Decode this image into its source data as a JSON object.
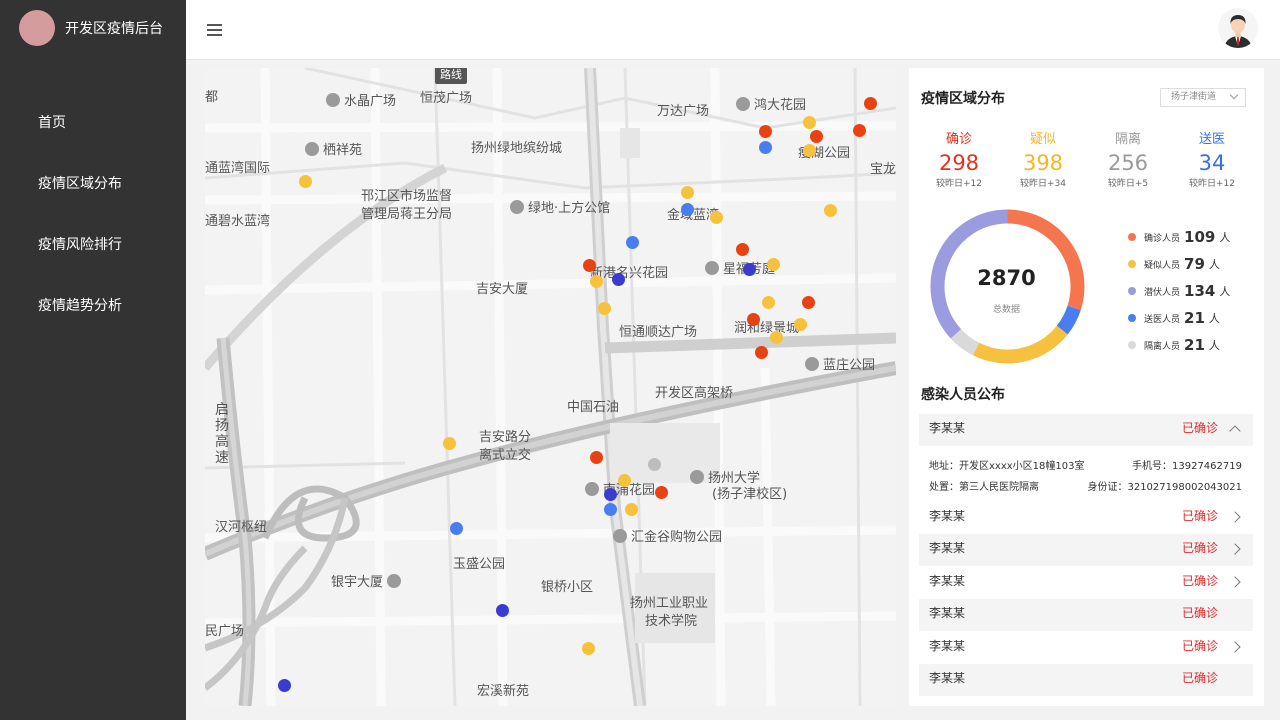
{
  "app": {
    "title": "开发区疫情后台"
  },
  "nav": {
    "items": [
      {
        "label": "首页"
      },
      {
        "label": "疫情区域分布"
      },
      {
        "label": "疫情风险排行"
      },
      {
        "label": "疫情趋势分析"
      }
    ]
  },
  "map": {
    "labels": [
      "都",
      "水晶广场",
      "恒茂广场",
      "万达广场",
      "鸿大花园",
      "栖祥苑",
      "扬州绿地缤纷城",
      "瘦湖公园",
      "宝龙",
      "通蓝湾国际",
      "邗江区市场监督",
      "管理局蒋王分局",
      "绿地·上方公馆",
      "金域蓝湾",
      "通碧水蓝湾",
      "新港名兴花园",
      "星福芳庭",
      "吉安大厦",
      "恒通顺达广场",
      "润和绿景城",
      "中国石油",
      "开发区高架桥",
      "蓝庄公园",
      "启扬高速",
      "吉安路分",
      "离式立交",
      "南浦花园",
      "扬州大学",
      "(扬子津校区)",
      "汉河枢纽",
      "汇金谷购物公园",
      "玉盛公园",
      "银宇大厦",
      "银桥小区",
      "扬州工业职业",
      "技术学院",
      "民广场",
      "宏溪新苑",
      "路线"
    ]
  },
  "panel": {
    "title": "疫情区域分布",
    "district_select": "扬子津街道",
    "stats": [
      {
        "label": "确诊",
        "value": "298",
        "sub": "较昨日+12",
        "color": "#e0341c"
      },
      {
        "label": "疑似",
        "value": "398",
        "sub": "较昨日+34",
        "color": "#f5b52b"
      },
      {
        "label": "隔离",
        "value": "256",
        "sub": "较昨日+5",
        "color": "#9a9a9a"
      },
      {
        "label": "送医",
        "value": "34",
        "sub": "较昨日+12",
        "color": "#3a6fe8"
      }
    ],
    "total": {
      "value": "2870",
      "label": "总数据"
    },
    "legend": [
      {
        "label": "确诊人员",
        "value": "109",
        "unit": "人",
        "color": "#f5764e"
      },
      {
        "label": "疑似人员",
        "value": "79",
        "unit": "人",
        "color": "#f7c140"
      },
      {
        "label": "潜伏人员",
        "value": "134",
        "unit": "人",
        "color": "#9b9be0"
      },
      {
        "label": "送医人员",
        "value": "21",
        "unit": "人",
        "color": "#4a7ef0"
      },
      {
        "label": "隔离人员",
        "value": "21",
        "unit": "人",
        "color": "#d9d9d9"
      }
    ],
    "infected_title": "感染人员公布",
    "infected": [
      {
        "name": "李某某",
        "status": "已确诊",
        "expanded": true,
        "address": "地址：开发区xxxx小区18幢103室",
        "phone": "手机号：13927462719",
        "disposal": "处置：第三人民医院隔离",
        "id_card": "身份证：321027198002043021"
      },
      {
        "name": "李某某",
        "status": "已确诊"
      },
      {
        "name": "李某某",
        "status": "已确诊"
      },
      {
        "name": "李某某",
        "status": "已确诊"
      },
      {
        "name": "李某某",
        "status": "已确诊"
      },
      {
        "name": "李某某",
        "status": "已确诊"
      },
      {
        "name": "李某某",
        "status": "已确诊"
      }
    ]
  },
  "icons": {
    "menu": "menu-icon",
    "avatar": "user-avatar",
    "chevron": "chevron-icon"
  }
}
